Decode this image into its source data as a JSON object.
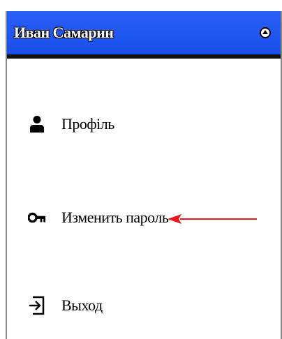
{
  "header": {
    "user_name": "Иван Самарин",
    "toggle_icon": "chevron-up-icon",
    "background_color": "#1f57f0"
  },
  "menu": {
    "items": [
      {
        "label": "Профіль",
        "icon": "user-icon"
      },
      {
        "label": "Изменить пароль",
        "icon": "key-icon"
      },
      {
        "label": "Выход",
        "icon": "logout-icon"
      }
    ]
  },
  "annotation": {
    "arrow_color": "#e8171a",
    "icon": "arrow-left-icon"
  }
}
